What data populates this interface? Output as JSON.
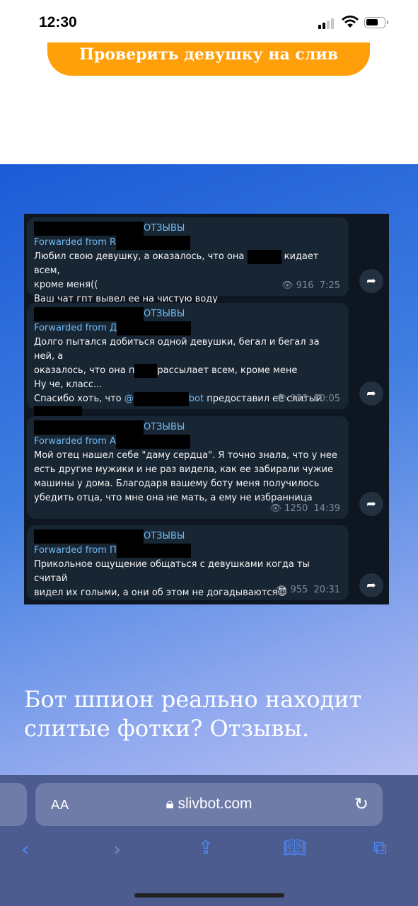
{
  "status": {
    "time": "12:30"
  },
  "cta": {
    "label": "Проверить девушку на слив",
    "color": "#ff9f0a"
  },
  "reviews": [
    {
      "channel": "ОТЗЫВЫ",
      "forwarded": "Forwarded from R",
      "lines": [
        "Любил свою девушку, а оказалось, что она",
        "кидает всем,",
        "кроме меня((",
        "Ваш чат гпт вывел ее на чистую воду"
      ],
      "views": "916",
      "time": "7:25"
    },
    {
      "channel": "ОТЗЫВЫ",
      "forwarded": "Forwarded from Д",
      "lines": [
        "Долго пытался добиться одной девушки, бегал и бегал за ней, а",
        "оказалось, что она п",
        "рассылает всем, кроме мене",
        "Ну че, класс...",
        "Спасибо хоть, что",
        "@",
        "bot",
        "предоставил её слитый"
      ],
      "views": "933",
      "time": "10:05"
    },
    {
      "channel": "ОТЗЫВЫ",
      "forwarded": "Forwarded from А",
      "lines": [
        "Мой отец нашел себе \"даму сердца\". Я точно знала, что у нее",
        "есть другие мужики и не раз видела, как ее забирали чужие",
        "машины у дома. Благодаря вашему боту меня получилось",
        "убедить отца, что мне она не мать, а ему не избранница"
      ],
      "views": "1250",
      "time": "14:39"
    },
    {
      "channel": "ОТЗЫВЫ",
      "forwarded": "Forwarded from П",
      "lines": [
        "Прикольное ощущение общаться с девушками когда ты считай",
        "видел их голыми, а они об этом не догадываются",
        "😈"
      ],
      "views": "955",
      "time": "20:31"
    }
  ],
  "heading": "Бот шпион реально находит слитые фотки? Отзывы.",
  "browser": {
    "aa": "AA",
    "url": "slivbot.com"
  }
}
